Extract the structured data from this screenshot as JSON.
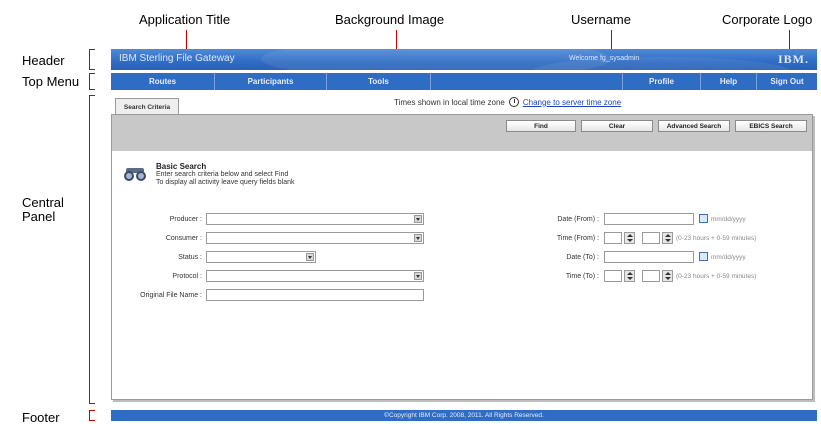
{
  "annotations": {
    "application_title": "Application Title",
    "background_image": "Background Image",
    "username": "Username",
    "corporate_logo": "Corporate Logo",
    "header": "Header",
    "top_menu": "Top Menu",
    "central_panel_line1": "Central",
    "central_panel_line2": "Panel",
    "footer": "Footer"
  },
  "header": {
    "app_title": "IBM Sterling File Gateway",
    "welcome": "Welcome fg_sysadmin",
    "logo": "IBM."
  },
  "menu": {
    "routes": "Routes",
    "participants": "Participants",
    "tools": "Tools",
    "profile": "Profile",
    "help": "Help",
    "sign_out": "Sign Out"
  },
  "central": {
    "tab_label": "Search Criteria",
    "tz_text": "Times shown in local time zone",
    "tz_link": "Change to server time zone",
    "buttons": {
      "find": "Find",
      "clear": "Clear",
      "advanced": "Advanced Search",
      "ebics": "EBICS Search"
    },
    "basic": {
      "title": "Basic Search",
      "line1": "Enter search criteria below and select Find",
      "line2": "To display all activity leave query fields blank"
    },
    "fields": {
      "producer": "Producer :",
      "consumer": "Consumer :",
      "status": "Status :",
      "protocol": "Protocol :",
      "original_file_name": "Original File Name :",
      "date_from": "Date (From) :",
      "time_from": "Time (From) :",
      "date_to": "Date (To) :",
      "time_to": "Time (To) :"
    },
    "hints": {
      "date_format": "mm/dd/yyyy",
      "time_format": "(0-23 hours + 0-59 minutes)"
    }
  },
  "footer": {
    "copyright": "©Copyright IBM Corp. 2008, 2011. All Rights Reserved."
  }
}
